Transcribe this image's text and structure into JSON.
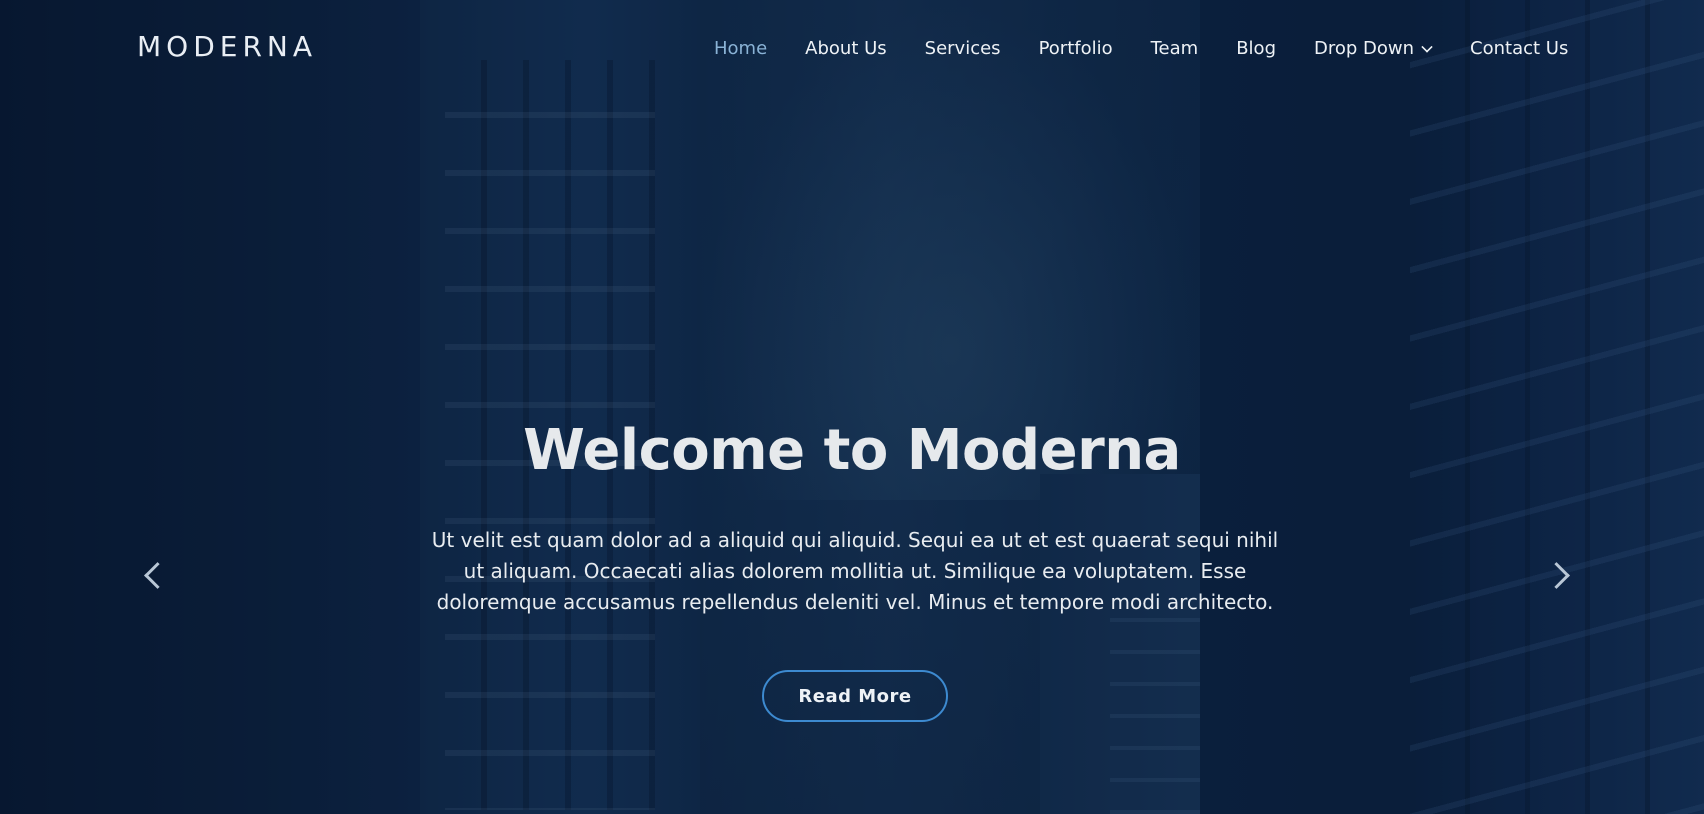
{
  "brand": {
    "logo_text": "MODERNA"
  },
  "nav": {
    "items": [
      {
        "label": "Home",
        "active": true
      },
      {
        "label": "About Us"
      },
      {
        "label": "Services"
      },
      {
        "label": "Portfolio"
      },
      {
        "label": "Team"
      },
      {
        "label": "Blog"
      },
      {
        "label": "Drop Down",
        "has_dropdown": true,
        "icon": "chevron-down-icon"
      },
      {
        "label": "Contact Us"
      }
    ]
  },
  "hero": {
    "title": "Welcome to Moderna",
    "description": "Ut velit est quam dolor ad a aliquid qui aliquid. Sequi ea ut et est quaerat sequi nihil ut aliquam. Occaecati alias dolorem mollitia ut. Similique ea voluptatem. Esse doloremque accusamus repellendus deleniti vel. Minus et tempore modi architecto.",
    "button_label": "Read More",
    "prev_icon": "chevron-left-icon",
    "next_icon": "chevron-right-icon"
  },
  "colors": {
    "accent": "#3d8ad0",
    "active_nav": "#8ab3d6",
    "overlay": "#0d2440"
  }
}
